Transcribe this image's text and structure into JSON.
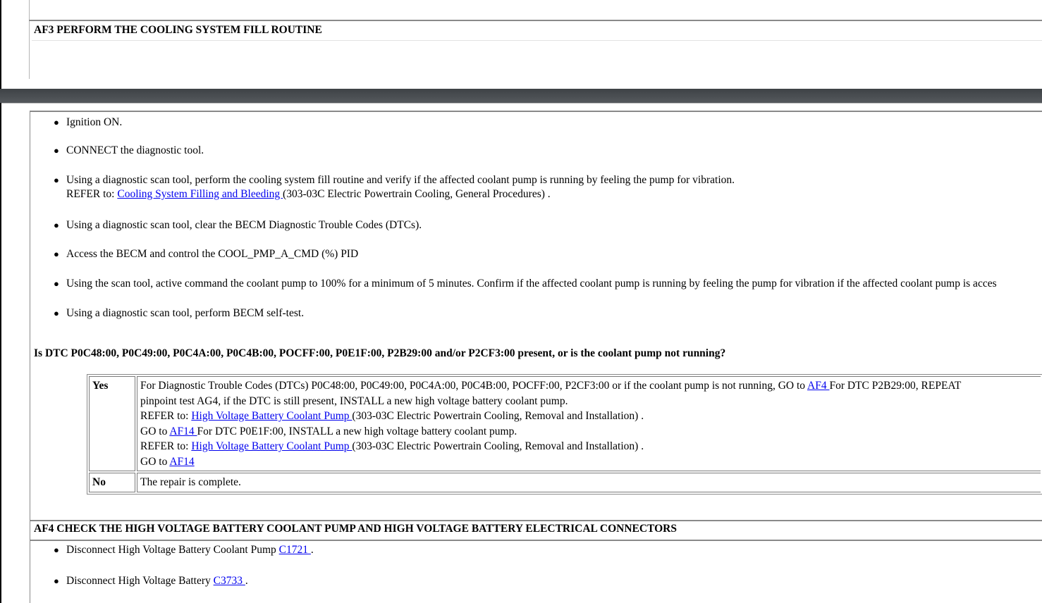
{
  "af3": {
    "title": "AF3 PERFORM THE COOLING SYSTEM FILL ROUTINE",
    "steps": [
      {
        "text": "Ignition ON."
      },
      {
        "text": "CONNECT the diagnostic tool."
      },
      {
        "text": "Using a diagnostic scan tool, perform the cooling system fill routine and verify if the affected coolant pump is running by feeling the pump for vibration.",
        "refer_prefix": "REFER to: ",
        "refer_link": "Cooling System Filling and Bleeding ",
        "refer_suffix": "(303-03C Electric Powertrain Cooling, General Procedures) ."
      },
      {
        "text": "Using a diagnostic scan tool, clear the BECM Diagnostic Trouble Codes (DTCs)."
      },
      {
        "text": "Access the BECM and control the COOL_PMP_A_CMD (%) PID"
      },
      {
        "text": "Using the scan tool, active command the coolant pump to 100% for a minimum of 5 minutes. Confirm if the affected coolant pump is running by feeling the pump for vibration if the affected coolant pump is acces"
      },
      {
        "text": "Using a diagnostic scan tool, perform BECM self-test."
      }
    ],
    "bullet_glyph": "●",
    "question": "Is DTC P0C48:00, P0C49:00, P0C4A:00, P0C4B:00, POCFF:00, P0E1F:00, P2B29:00 and/or P2CF3:00 present, or is the coolant pump not running?",
    "yes": {
      "label": "Yes",
      "l1_text": "For Diagnostic Trouble Codes (DTCs) P0C48:00, P0C49:00, P0C4A:00, P0C4B:00, POCFF:00, P2CF3:00 or if the coolant pump is not running, GO to ",
      "l1_link": "AF4 ",
      "l1_after": "For DTC P2B29:00, REPEAT",
      "l2_text": "pinpoint test AG4, if the DTC is still present, INSTALL a new high voltage battery coolant pump.",
      "l3_prefix": "REFER to: ",
      "l3_link": "High Voltage Battery Coolant Pump ",
      "l3_suffix": "(303-03C Electric Powertrain Cooling, Removal and Installation) .",
      "l4_prefix": "GO to ",
      "l4_link": "AF14 ",
      "l4_suffix": "For DTC P0E1F:00, INSTALL a new high voltage battery coolant pump.",
      "l5_prefix": "REFER to: ",
      "l5_link": "High Voltage Battery Coolant Pump ",
      "l5_suffix": "(303-03C Electric Powertrain Cooling, Removal and Installation) .",
      "l6_prefix": "GO to ",
      "l6_link": "AF14 "
    },
    "no": {
      "label": "No",
      "text": "The repair is complete."
    }
  },
  "af4": {
    "title": "AF4 CHECK THE HIGH VOLTAGE BATTERY COOLANT PUMP AND HIGH VOLTAGE BATTERY ELECTRICAL CONNECTORS",
    "steps": [
      {
        "prefix": "Disconnect High Voltage Battery Coolant Pump ",
        "link": "C1721 ",
        "suffix": "."
      },
      {
        "prefix": "Disconnect High Voltage Battery ",
        "link": "C3733 ",
        "suffix": "."
      }
    ]
  },
  "colors": {
    "link": "#0000ee",
    "band": "#4a4e52",
    "border": "#8a8a8a"
  }
}
